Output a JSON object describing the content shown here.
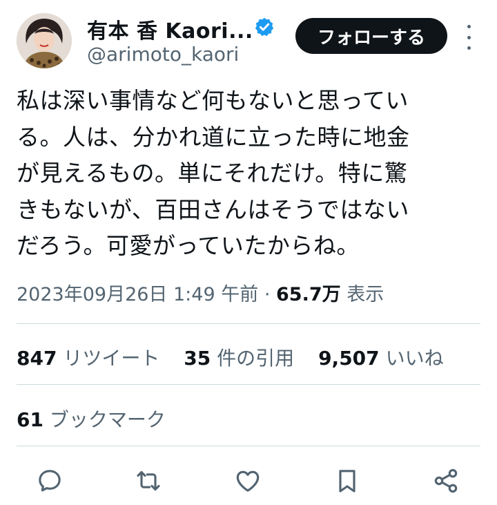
{
  "author": {
    "display_name": "有本 香 Kaori...",
    "handle": "@arimoto_kaori",
    "verified_icon": "verified-badge-icon",
    "follow_label": "フォローする"
  },
  "tweet": {
    "lines": [
      "私は深い事情など何もないと思ってい",
      "る。人は、分かれ道に立った時に地金",
      "が見えるもの。単にそれだけ。特に驚",
      "きもないが、百田さんはそうではない",
      "だろう。可愛がっていたからね。"
    ],
    "timestamp": "2023年09月26日 1:49 午前",
    "separator": "·",
    "views_count": "65.7万",
    "views_label": "表示"
  },
  "stats": {
    "retweets": {
      "count": "847",
      "label": "リツイート"
    },
    "quotes": {
      "count": "35",
      "label": "件の引用"
    },
    "likes": {
      "count": "9,507",
      "label": "いいね"
    },
    "bookmarks": {
      "count": "61",
      "label": "ブックマーク"
    }
  },
  "actions": [
    "reply-icon",
    "retweet-icon",
    "like-icon",
    "bookmark-icon",
    "share-icon"
  ],
  "colors": {
    "text": "#0f1419",
    "secondary": "#536471",
    "verified": "#1d9bf0",
    "divider": "#cfd9de",
    "button_bg": "#0f1419"
  }
}
